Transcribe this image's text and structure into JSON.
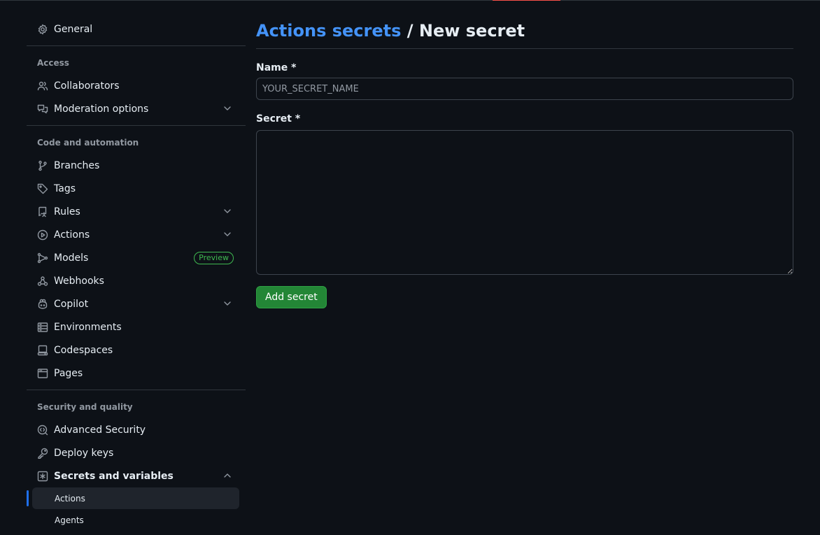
{
  "sidebar": {
    "general": "General",
    "sections": {
      "access": "Access",
      "code": "Code and automation",
      "security": "Security and quality"
    },
    "access_items": {
      "collaborators": "Collaborators",
      "moderation": "Moderation options"
    },
    "code_items": {
      "branches": "Branches",
      "tags": "Tags",
      "rules": "Rules",
      "actions": "Actions",
      "models": "Models",
      "models_badge": "Preview",
      "webhooks": "Webhooks",
      "copilot": "Copilot",
      "environments": "Environments",
      "codespaces": "Codespaces",
      "pages": "Pages"
    },
    "security_items": {
      "advanced_security": "Advanced Security",
      "deploy_keys": "Deploy keys",
      "secrets": "Secrets and variables",
      "sub_actions": "Actions",
      "sub_agents": "Agents"
    }
  },
  "main": {
    "breadcrumb_link": "Actions secrets",
    "breadcrumb_sep": " / ",
    "page_title": "New secret",
    "name_label": "Name *",
    "name_placeholder": "YOUR_SECRET_NAME",
    "name_value": "",
    "secret_label": "Secret *",
    "secret_value": "",
    "submit_label": "Add secret"
  },
  "colors": {
    "background": "#0d1117",
    "link": "#4493f8",
    "primary_button": "#238636",
    "active_indicator": "#1f6feb",
    "badge": "#3fb950",
    "top_accent": "#f85149"
  }
}
